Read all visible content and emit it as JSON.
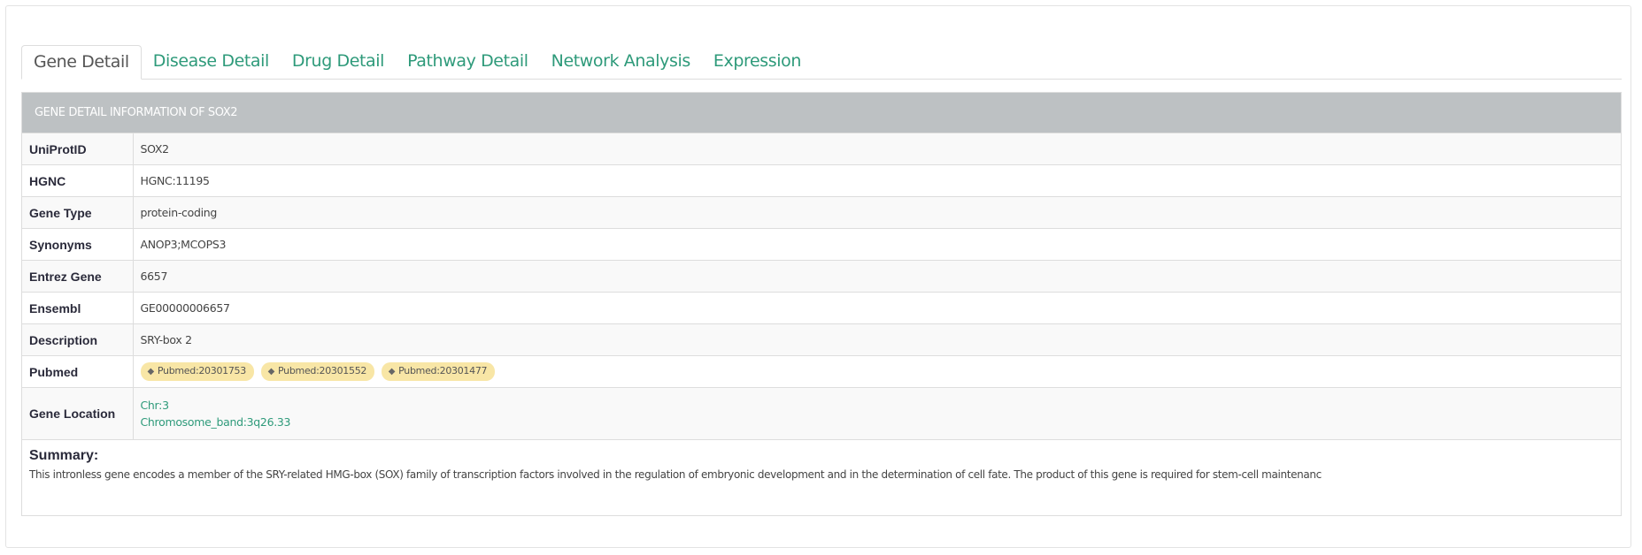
{
  "tabs": [
    {
      "label": "Gene Detail",
      "active": true
    },
    {
      "label": "Disease Detail",
      "active": false
    },
    {
      "label": "Drug Detail",
      "active": false
    },
    {
      "label": "Pathway Detail",
      "active": false
    },
    {
      "label": "Network Analysis",
      "active": false
    },
    {
      "label": "Expression",
      "active": false
    }
  ],
  "panel": {
    "heading": "GENE DETAIL INFORMATION OF SOX2",
    "rows": {
      "uniprot": {
        "label": "UniProtID",
        "value": "SOX2"
      },
      "hgnc": {
        "label": "HGNC",
        "value": "HGNC:11195"
      },
      "gene_type": {
        "label": "Gene Type",
        "value": "protein-coding"
      },
      "synonyms": {
        "label": "Synonyms",
        "value": "ANOP3;MCOPS3"
      },
      "entrez": {
        "label": "Entrez Gene",
        "value": "6657"
      },
      "ensembl": {
        "label": "Ensembl",
        "value": "GE00000006657"
      },
      "description": {
        "label": "Description",
        "value": "SRY-box 2"
      },
      "pubmed": {
        "label": "Pubmed",
        "tags": [
          "Pubmed:20301753",
          "Pubmed:20301552",
          "Pubmed:20301477"
        ]
      },
      "location": {
        "label": "Gene Location",
        "chr": "Chr:3",
        "band": "Chromosome_band:3q26.33"
      }
    },
    "summary": {
      "title": "Summary:",
      "text": "This intronless gene encodes a member of the SRY-related HMG-box (SOX) family of transcription factors involved in the regulation of embryonic development and in the determination of cell fate. The product of this gene is required for stem-cell maintenanc"
    }
  },
  "colors": {
    "accent": "#2e9a7a",
    "heading_bg": "#bdc1c3",
    "tag_bg": "#f8e6a6"
  },
  "icons": {
    "tag": "tag-icon"
  }
}
